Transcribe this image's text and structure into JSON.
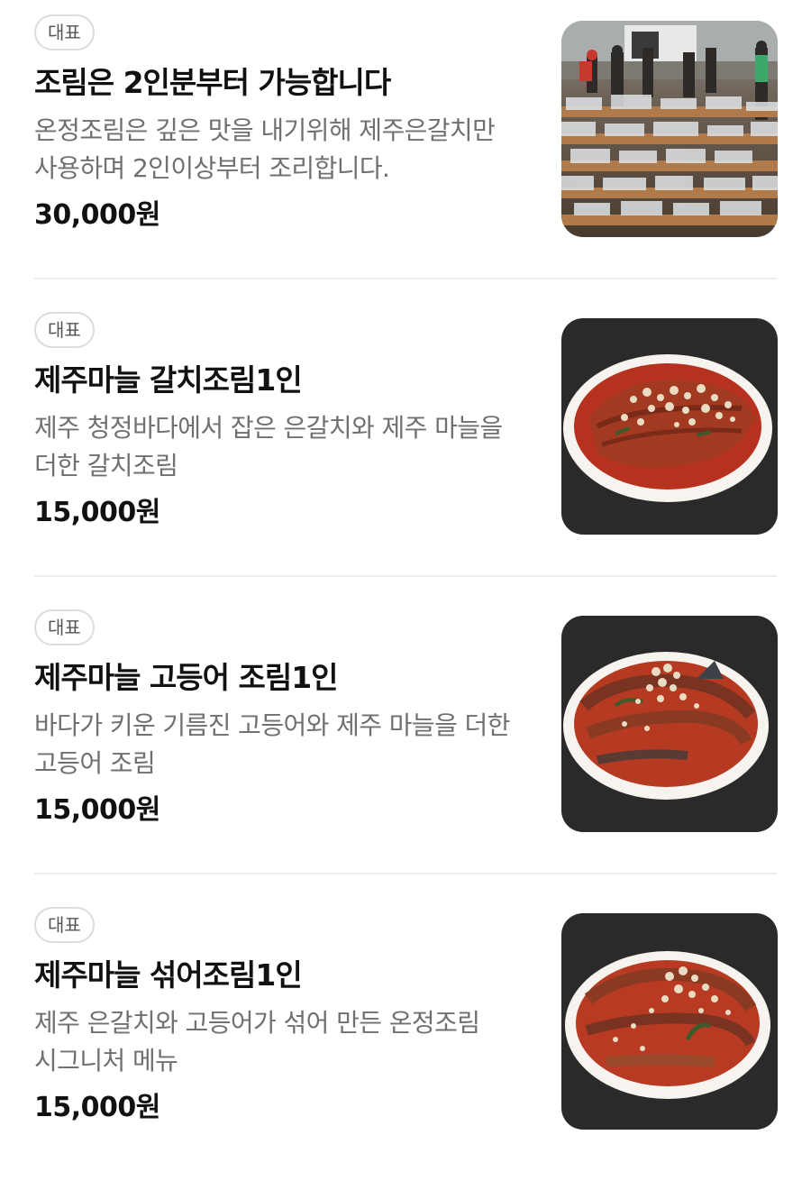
{
  "menu": {
    "items": [
      {
        "badge": "대표",
        "title": "조림은 2인분부터 가능합니다",
        "description": "온정조림은 깊은 맛을 내기위해 제주은갈치만 사용하며 2인이상부터 조리합니다.",
        "price": "30,000원",
        "image": "fish-market-photo"
      },
      {
        "badge": "대표",
        "title": "제주마늘 갈치조림1인",
        "description": "제주 청정바다에서 잡은 은갈치와 제주 마늘을 더한 갈치조림",
        "price": "15,000원",
        "image": "braised-cutlassfish-photo"
      },
      {
        "badge": "대표",
        "title": "제주마늘 고등어 조림1인",
        "description": "바다가 키운 기름진 고등어와 제주 마늘을 더한 고등어 조림",
        "price": "15,000원",
        "image": "braised-mackerel-photo"
      },
      {
        "badge": "대표",
        "title": "제주마늘 섞어조림1인",
        "description": "제주 은갈치와 고등어가 섞어 만든 온정조림 시그니처 메뉴",
        "price": "15,000원",
        "image": "braised-mixed-fish-photo"
      }
    ]
  }
}
